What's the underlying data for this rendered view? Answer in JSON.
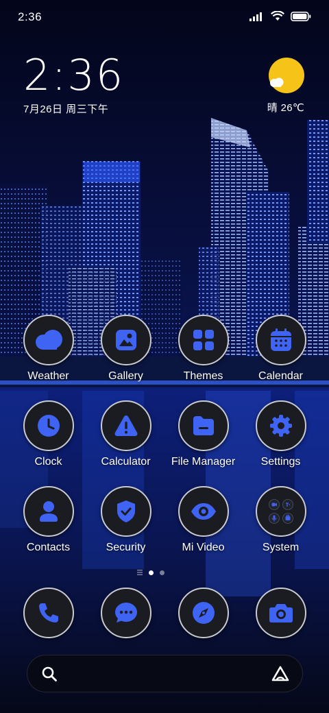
{
  "status_bar": {
    "time": "2:36",
    "icons": [
      "signal-icon",
      "wifi-icon",
      "battery-icon"
    ]
  },
  "clock_widget": {
    "time": "2:36",
    "date": "7月26日 周三下午"
  },
  "weather_widget": {
    "condition_icon": "sun-cloud-icon",
    "text": "晴 26℃"
  },
  "apps": [
    {
      "label": "Weather",
      "icon": "weather-icon"
    },
    {
      "label": "Gallery",
      "icon": "gallery-icon"
    },
    {
      "label": "Themes",
      "icon": "themes-icon"
    },
    {
      "label": "Calendar",
      "icon": "calendar-icon"
    },
    {
      "label": "Clock",
      "icon": "clock-icon"
    },
    {
      "label": "Calculator",
      "icon": "calculator-icon"
    },
    {
      "label": "File Manager",
      "icon": "file-manager-icon"
    },
    {
      "label": "Settings",
      "icon": "settings-icon"
    },
    {
      "label": "Contacts",
      "icon": "contacts-icon"
    },
    {
      "label": "Security",
      "icon": "security-icon"
    },
    {
      "label": "Mi Video",
      "icon": "mi-video-icon"
    },
    {
      "label": "System",
      "icon": "system-folder-icon"
    }
  ],
  "page_indicator": {
    "pages": 2,
    "current": 1
  },
  "dock": [
    {
      "icon": "phone-icon"
    },
    {
      "icon": "messages-icon"
    },
    {
      "icon": "browser-icon"
    },
    {
      "icon": "camera-icon"
    }
  ],
  "search_bar": {
    "icons": [
      "search-icon",
      "assistant-icon"
    ]
  },
  "colors": {
    "icon_accent": "#3f63f2",
    "icon_background": "#1b1c22",
    "icon_ring": "#c9cbd2",
    "sun": "#f6c418"
  }
}
